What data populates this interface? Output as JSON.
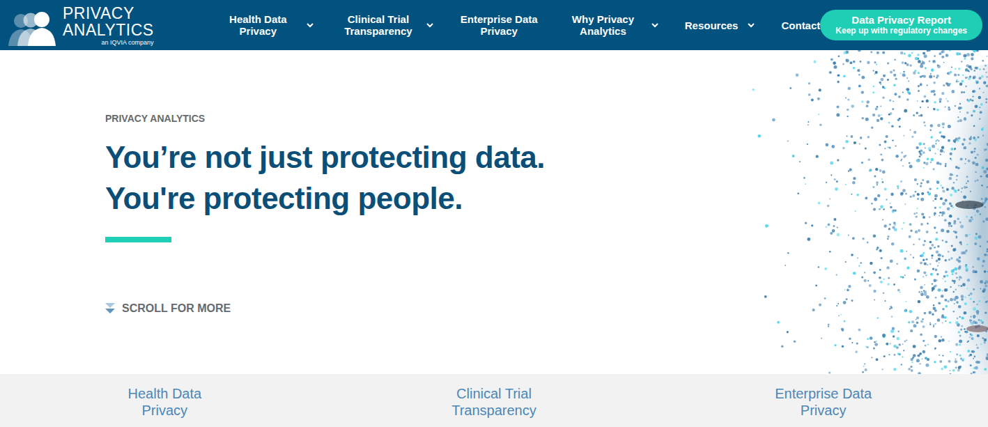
{
  "logo": {
    "line1": "PRIVACY",
    "line2": "ANALYTICS",
    "tagline": "an IQVIA company"
  },
  "nav": [
    {
      "label": "Health Data Privacy",
      "kind": "dropdown"
    },
    {
      "label": "Clinical Trial Transparency",
      "kind": "dropdown"
    },
    {
      "label": "Enterprise Data Privacy",
      "kind": "link"
    },
    {
      "label": "Why Privacy Analytics",
      "kind": "dropdown"
    },
    {
      "label": "Resources",
      "kind": "dropdown"
    },
    {
      "label": "Contact",
      "kind": "link"
    }
  ],
  "cta": {
    "title": "Data Privacy Report",
    "subtitle": "Keep up with regulatory changes"
  },
  "hero": {
    "eyebrow": "PRIVACY ANALYTICS",
    "headline": [
      "You’re not just protecting data.",
      "You're protecting people."
    ],
    "scroll": "SCROLL FOR MORE"
  },
  "categories": [
    "Health Data Privacy",
    "Clinical Trial Transparency",
    "Enterprise Data Privacy"
  ]
}
